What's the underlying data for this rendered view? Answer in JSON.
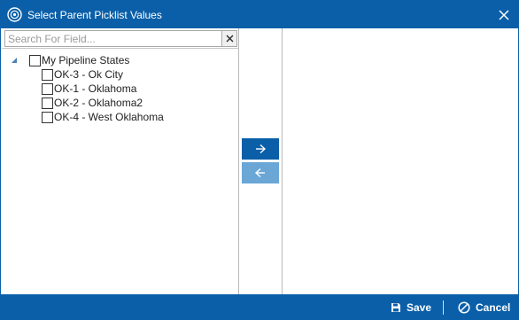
{
  "window": {
    "title": "Select Parent Picklist Values",
    "icon": "app-logo-icon",
    "accent_color": "#0a5fa8"
  },
  "search": {
    "placeholder": "Search For Field...",
    "value": ""
  },
  "tree": {
    "root": {
      "label": "My Pipeline States",
      "expanded": true,
      "checked": false
    },
    "children": [
      {
        "label": "OK-3 - Ok City",
        "checked": false
      },
      {
        "label": "OK-1 - Oklahoma",
        "checked": false
      },
      {
        "label": "OK-2 - Oklahoma2",
        "checked": false
      },
      {
        "label": "OK-4 - West Oklahoma",
        "checked": false
      }
    ]
  },
  "move_buttons": {
    "add_icon": "arrow-right-icon",
    "remove_icon": "arrow-left-icon"
  },
  "footer": {
    "save_label": "Save",
    "cancel_label": "Cancel"
  }
}
